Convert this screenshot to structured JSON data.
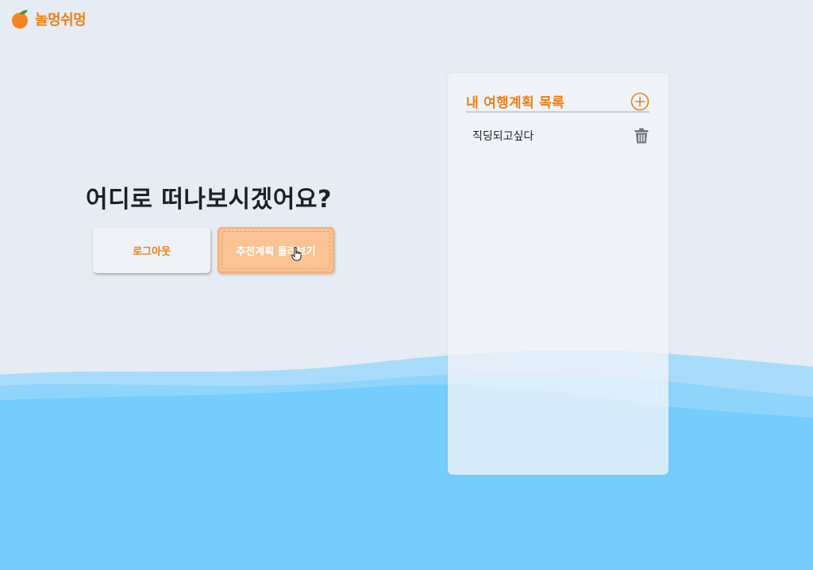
{
  "app": {
    "name": "놀멍쉬멍",
    "logo_icon": "orange-fruit-icon"
  },
  "hero": {
    "title": "어디로 떠나보시겠어요?"
  },
  "buttons": {
    "logout_label": "로그아웃",
    "recommend_label": "추천계획 둘러보기"
  },
  "plans_panel": {
    "title": "내 여행계획 목록",
    "add_icon": "plus-circle-icon",
    "items": [
      {
        "name": "직딩되고싶다",
        "delete_icon": "trash-icon"
      }
    ]
  },
  "colors": {
    "accent": "#f07f12",
    "background": "#e6ecf3",
    "water": "#75cdfc",
    "recommend_button": "#f9c393"
  }
}
